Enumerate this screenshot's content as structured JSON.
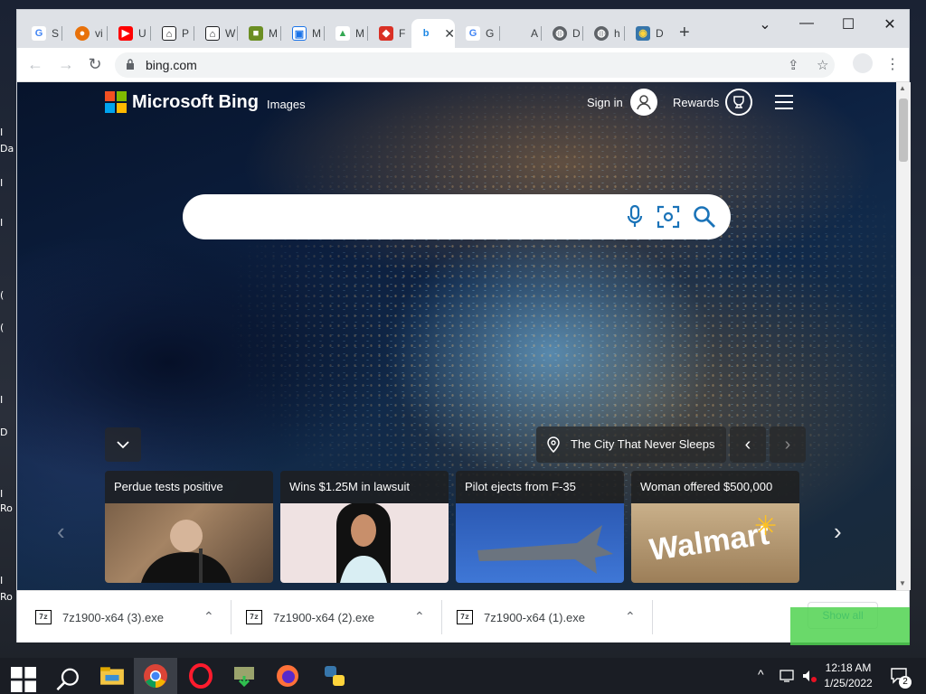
{
  "desktop": {
    "labels": [
      "I",
      "Da",
      "I",
      "I",
      "(",
      "(",
      "I",
      "D",
      "I",
      "Ro",
      "I",
      "Ro"
    ]
  },
  "browser": {
    "tabs": [
      {
        "favicon": "G",
        "label": "S",
        "color": "#4285f4"
      },
      {
        "favicon": "●",
        "label": "vi",
        "color": "#e8710a"
      },
      {
        "favicon": "▶",
        "label": "U",
        "color": "#ff0000"
      },
      {
        "favicon": "⌂",
        "label": "P",
        "color": "#202124"
      },
      {
        "favicon": "⌂",
        "label": "W",
        "color": "#202124"
      },
      {
        "favicon": "■",
        "label": "M",
        "color": "#6b8e23"
      },
      {
        "favicon": "▣",
        "label": "M",
        "color": "#1a73e8"
      },
      {
        "favicon": "▲",
        "label": "M",
        "color": "#34a853"
      },
      {
        "favicon": "◆",
        "label": "F",
        "color": "#d93025"
      },
      {
        "favicon": "b",
        "label": "",
        "color": "#1e88e5",
        "active": true
      },
      {
        "favicon": "G",
        "label": "G",
        "color": "#4285f4"
      },
      {
        "favicon": "",
        "label": "A",
        "color": "#ffffff"
      },
      {
        "favicon": "◍",
        "label": "D",
        "color": "#5f6368"
      },
      {
        "favicon": "◍",
        "label": "h",
        "color": "#5f6368"
      },
      {
        "favicon": "◉",
        "label": "D",
        "color": "#3776ab"
      }
    ],
    "url": "bing.com"
  },
  "bing": {
    "brand": "Microsoft Bing",
    "nav_images": "Images",
    "sign_in": "Sign in",
    "rewards": "Rewards",
    "image_caption": "The City That Never Sleeps",
    "news": [
      {
        "title": "Perdue tests positive"
      },
      {
        "title": "Wins $1.25M in lawsuit"
      },
      {
        "title": "Pilot ejects from F-35"
      },
      {
        "title": "Woman offered $500,000",
        "image_text": "Walmart"
      }
    ]
  },
  "downloads": {
    "items": [
      {
        "name": "7z1900-x64 (3).exe",
        "icon": "7z"
      },
      {
        "name": "7z1900-x64 (2).exe",
        "icon": "7z"
      },
      {
        "name": "7z1900-x64 (1).exe",
        "icon": "7z"
      }
    ],
    "show_all": "Show all"
  },
  "taskbar": {
    "time": "12:18 AM",
    "date": "1/25/2022",
    "notifications": "2"
  }
}
